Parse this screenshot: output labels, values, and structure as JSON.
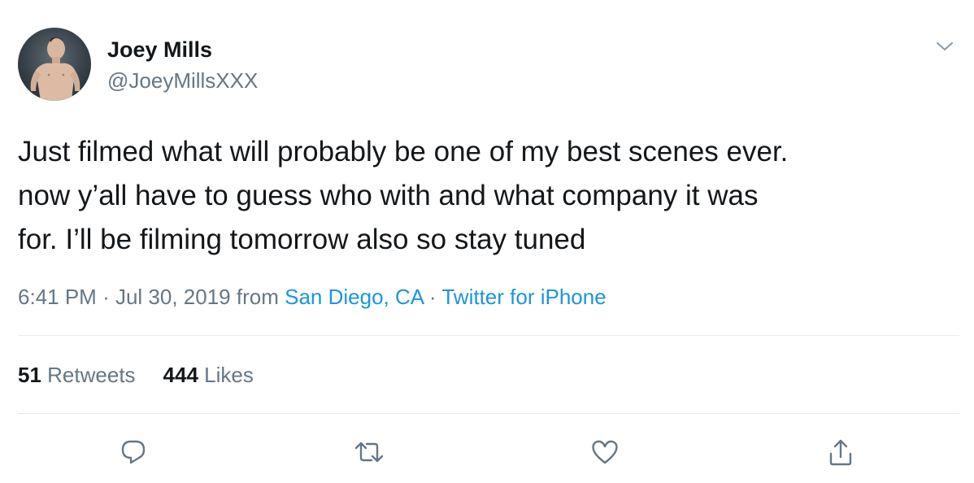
{
  "user": {
    "name": "Joey Mills",
    "handle": "@JoeyMillsXXX",
    "avatar_icon": "profile-photo"
  },
  "tweet": {
    "lines": [
      "Just filmed what will probably be one of my best scenes ever.",
      "now y’all have to guess who with and what company it was",
      "for. I’ll be filming tomorrow also so stay tuned"
    ]
  },
  "meta": {
    "time": "6:41 PM",
    "separator": "·",
    "date": "Jul 30, 2019",
    "from_word": "from",
    "location": "San Diego, CA",
    "source": "Twitter for iPhone"
  },
  "stats": {
    "retweets_count": "51",
    "retweets_label": "Retweets",
    "likes_count": "444",
    "likes_label": "Likes"
  },
  "colors": {
    "text": "#14171a",
    "secondary": "#657786",
    "link": "#1b95e0",
    "divider": "#e6ecf0"
  },
  "icons": {
    "menu": "chevron-down-icon",
    "reply": "reply-icon",
    "retweet": "retweet-icon",
    "like": "heart-icon",
    "share": "share-icon"
  }
}
